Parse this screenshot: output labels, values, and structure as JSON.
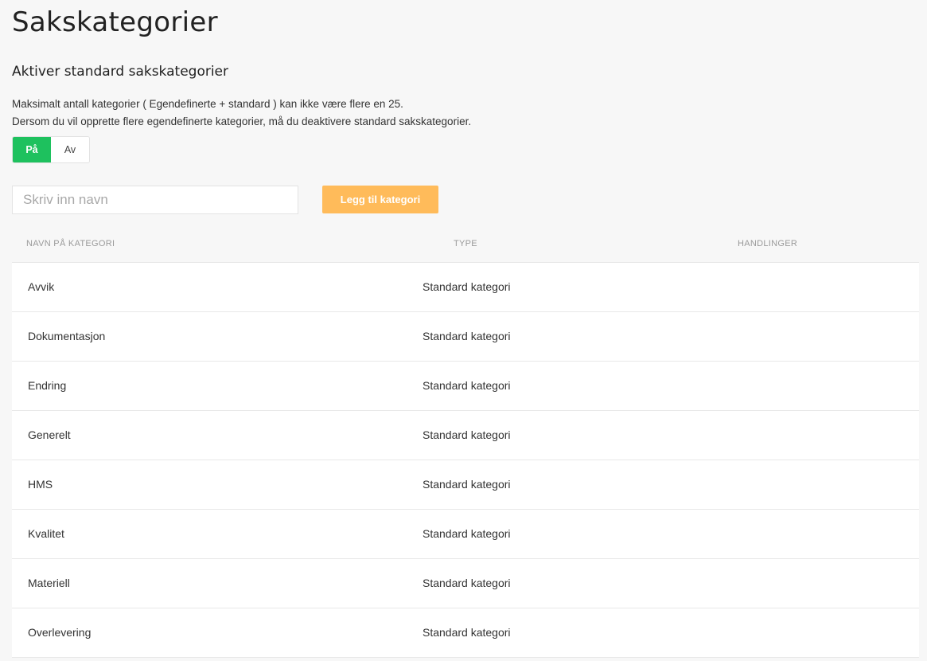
{
  "page": {
    "title": "Sakskategorier",
    "subtitle": "Aktiver standard sakskategorier",
    "desc_line1": "Maksimalt antall kategorier ( Egendefinerte + standard ) kan ikke være flere en 25.",
    "desc_line2": "Dersom du vil opprette flere egendefinerte kategorier, må du deaktivere standard sakskategorier."
  },
  "toggle": {
    "on_label": "På",
    "off_label": "Av",
    "selected": "På"
  },
  "form": {
    "placeholder": "Skriv inn navn",
    "value": "",
    "add_label": "Legg til kategori"
  },
  "table": {
    "headers": {
      "name": "NAVN PÅ KATEGORI",
      "type": "TYPE",
      "actions": "HANDLINGER"
    },
    "rows": [
      {
        "name": "Avvik",
        "type": "Standard kategori"
      },
      {
        "name": "Dokumentasjon",
        "type": "Standard kategori"
      },
      {
        "name": "Endring",
        "type": "Standard kategori"
      },
      {
        "name": "Generelt",
        "type": "Standard kategori"
      },
      {
        "name": "HMS",
        "type": "Standard kategori"
      },
      {
        "name": "Kvalitet",
        "type": "Standard kategori"
      },
      {
        "name": "Materiell",
        "type": "Standard kategori"
      },
      {
        "name": "Overlevering",
        "type": "Standard kategori"
      }
    ]
  },
  "colors": {
    "toggle_on": "#1ec15e",
    "add_button": "#ffbb5a",
    "background": "#f7f7f7"
  }
}
